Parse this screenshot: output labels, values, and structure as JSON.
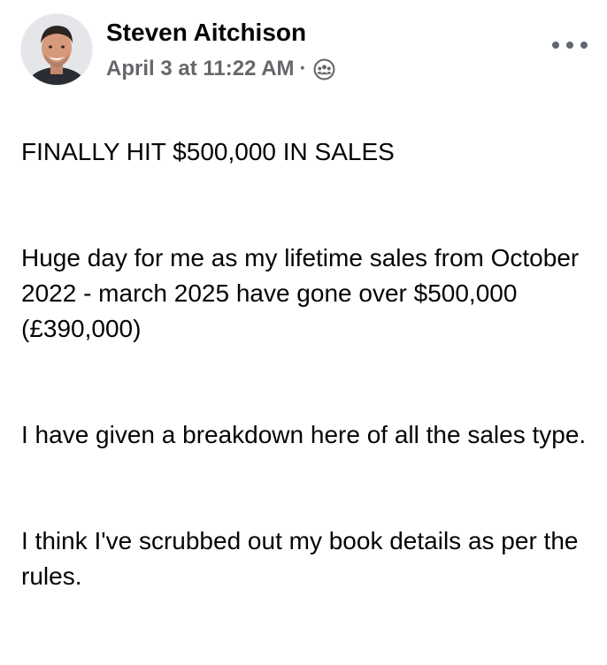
{
  "post": {
    "author": {
      "name": "Steven Aitchison",
      "avatar": "profile-photo"
    },
    "timestamp": "April 3 at 11:22 AM",
    "separator": "·",
    "audience_icon": "group-audience-icon",
    "more_icon": "more-options-icon",
    "paragraphs": [
      "FINALLY HIT $500,000 IN SALES",
      "Huge day for me as my lifetime sales from October 2022 - march 2025 have gone over $500,000 (£390,000)",
      "I have given a breakdown here of all the sales type.",
      "I think I've scrubbed out my book details as per the rules."
    ]
  },
  "colors": {
    "text_primary": "#050505",
    "text_secondary": "#65676b",
    "icon_gray": "#606770",
    "background": "#ffffff"
  }
}
